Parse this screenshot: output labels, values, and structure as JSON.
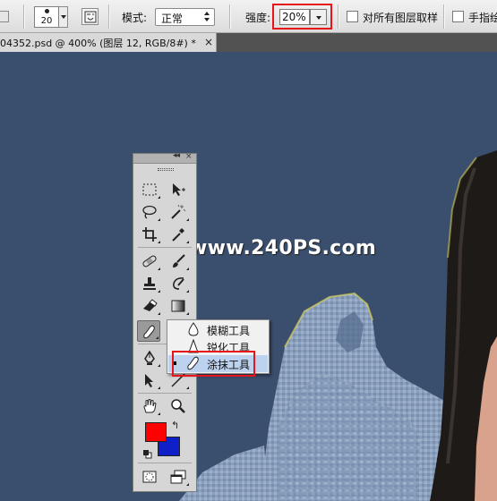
{
  "options_bar": {
    "brush_size": "20",
    "mode_label": "模式:",
    "mode_value": "正常",
    "strength_label": "强度:",
    "strength_value": "20%",
    "sample_all_layers_label": "对所有图层取样",
    "finger_painting_label": "手指绘"
  },
  "document_tab": {
    "title": "04352.psd @ 400% (图层 12, RGB/8#) *",
    "close_glyph": "×"
  },
  "canvas": {
    "watermark": "www.240PS.com"
  },
  "tools_panel": {
    "collapse_glyph": "◂◂",
    "close_glyph": "×",
    "foreground_color": "#ff0000",
    "background_color": "#1020c8"
  },
  "flyout": {
    "items": [
      {
        "label": "模糊工具",
        "icon": "blur-drop-icon",
        "selected": false
      },
      {
        "label": "锐化工具",
        "icon": "sharpen-triangle-icon",
        "selected": false
      },
      {
        "label": "涂抹工具",
        "icon": "smudge-finger-icon",
        "selected": true
      }
    ]
  },
  "highlight_color": "#e8141c"
}
